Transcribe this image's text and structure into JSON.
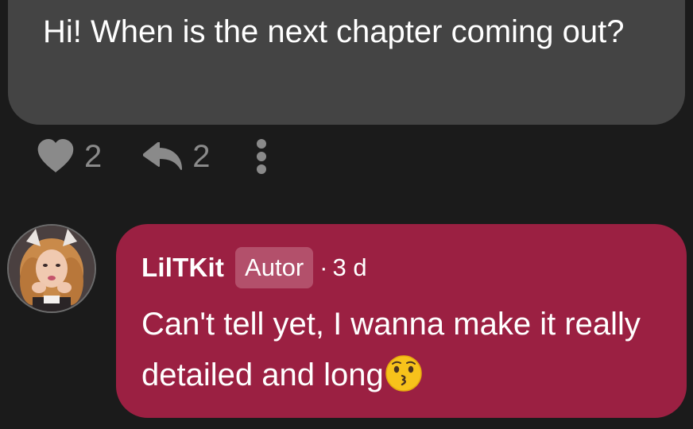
{
  "comment": {
    "text": "Hi! When is the next chapter coming out?",
    "likes": "2",
    "replies": "2"
  },
  "icons": {
    "like": "heart-icon",
    "reply": "reply-arrow-icon",
    "more": "vertical-dots-icon",
    "emoji": "kissing-face-emoji"
  },
  "reply": {
    "author": "LilTKit",
    "badge": "Autor",
    "separator": "·",
    "time": "3 d",
    "text": "Can't tell yet, I wanna make it really detailed and long"
  },
  "colors": {
    "background": "#1b1b1b",
    "comment_bubble": "#444444",
    "reply_bubble": "#9b2042",
    "badge": "#b3506b",
    "action_grey": "#8a8a8a"
  }
}
